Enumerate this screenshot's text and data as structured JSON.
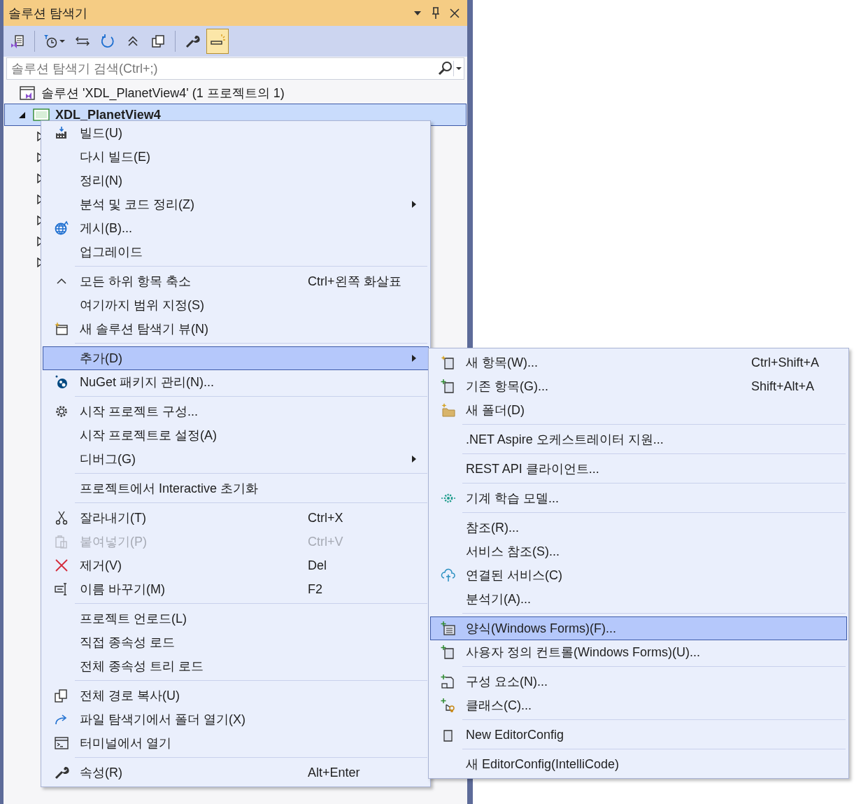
{
  "panel": {
    "title": "솔루션 탐색기"
  },
  "toolbar": {
    "buttons": [
      {
        "selected": false
      },
      {
        "selected": false
      },
      {
        "selected": false
      },
      {
        "selected": false
      },
      {
        "selected": false
      },
      {
        "selected": false
      },
      {
        "selected": false
      },
      {
        "selected": true
      }
    ]
  },
  "search": {
    "placeholder": "솔루션 탐색기 검색(Ctrl+;)"
  },
  "tree": {
    "solution": "솔루션 'XDL_PlanetView4'  (1 프로젝트의 1)",
    "project": {
      "label": "XDL_PlanetView4",
      "selected": true,
      "expanded": true,
      "children": [
        {
          "expanded": false
        },
        {
          "expanded": false
        },
        {
          "expanded": false
        },
        {
          "expanded": false
        },
        {
          "expanded": false
        },
        {
          "expanded": false
        },
        {
          "expanded": false
        }
      ]
    }
  },
  "context_menu": {
    "groups": [
      [
        {
          "label": "빌드(U)",
          "submenu": false,
          "selected": false,
          "disabled": false
        },
        {
          "label": "다시 빌드(E)",
          "submenu": false,
          "selected": false,
          "disabled": false
        },
        {
          "label": "정리(N)",
          "submenu": false,
          "selected": false,
          "disabled": false
        },
        {
          "label": "분석 및 코드 정리(Z)",
          "submenu": true,
          "selected": false,
          "disabled": false
        },
        {
          "label": "게시(B)...",
          "submenu": false,
          "selected": false,
          "disabled": false
        },
        {
          "label": "업그레이드",
          "submenu": false,
          "selected": false,
          "disabled": false
        }
      ],
      [
        {
          "label": "모든 하위 항목 축소",
          "shortcut": "Ctrl+왼쪽 화살표",
          "submenu": false,
          "selected": false,
          "disabled": false
        },
        {
          "label": "여기까지 범위 지정(S)",
          "submenu": false,
          "selected": false,
          "disabled": false
        },
        {
          "label": "새 솔루션 탐색기 뷰(N)",
          "submenu": false,
          "selected": false,
          "disabled": false
        }
      ],
      [
        {
          "label": "추가(D)",
          "submenu": true,
          "selected": true,
          "disabled": false
        },
        {
          "label": "NuGet 패키지 관리(N)...",
          "submenu": false,
          "selected": false,
          "disabled": false
        }
      ],
      [
        {
          "label": "시작 프로젝트 구성...",
          "submenu": false,
          "selected": false,
          "disabled": false
        },
        {
          "label": "시작 프로젝트로 설정(A)",
          "submenu": false,
          "selected": false,
          "disabled": false
        },
        {
          "label": "디버그(G)",
          "submenu": true,
          "selected": false,
          "disabled": false
        }
      ],
      [
        {
          "label": "프로젝트에서 Interactive 초기화",
          "submenu": false,
          "selected": false,
          "disabled": false
        }
      ],
      [
        {
          "label": "잘라내기(T)",
          "shortcut": "Ctrl+X",
          "submenu": false,
          "selected": false,
          "disabled": false
        },
        {
          "label": "붙여넣기(P)",
          "shortcut": "Ctrl+V",
          "submenu": false,
          "selected": false,
          "disabled": true
        },
        {
          "label": "제거(V)",
          "shortcut": "Del",
          "submenu": false,
          "selected": false,
          "disabled": false
        },
        {
          "label": "이름 바꾸기(M)",
          "shortcut": "F2",
          "submenu": false,
          "selected": false,
          "disabled": false
        }
      ],
      [
        {
          "label": "프로젝트 언로드(L)",
          "submenu": false,
          "selected": false,
          "disabled": false
        },
        {
          "label": "직접 종속성 로드",
          "submenu": false,
          "selected": false,
          "disabled": false
        },
        {
          "label": "전체 종속성 트리 로드",
          "submenu": false,
          "selected": false,
          "disabled": false
        }
      ],
      [
        {
          "label": "전체 경로 복사(U)",
          "submenu": false,
          "selected": false,
          "disabled": false
        },
        {
          "label": "파일 탐색기에서 폴더 열기(X)",
          "submenu": false,
          "selected": false,
          "disabled": false
        },
        {
          "label": "터미널에서 열기",
          "submenu": false,
          "selected": false,
          "disabled": false
        }
      ],
      [
        {
          "label": "속성(R)",
          "shortcut": "Alt+Enter",
          "submenu": false,
          "selected": false,
          "disabled": false
        }
      ]
    ]
  },
  "add_submenu": {
    "groups": [
      [
        {
          "label": "새 항목(W)...",
          "shortcut": "Ctrl+Shift+A",
          "selected": false
        },
        {
          "label": "기존 항목(G)...",
          "shortcut": "Shift+Alt+A",
          "selected": false
        },
        {
          "label": "새 폴더(D)",
          "selected": false
        }
      ],
      [
        {
          "label": ".NET Aspire 오케스트레이터 지원...",
          "selected": false
        }
      ],
      [
        {
          "label": "REST API 클라이언트...",
          "selected": false
        }
      ],
      [
        {
          "label": "기계 학습 모델...",
          "selected": false
        }
      ],
      [
        {
          "label": "참조(R)...",
          "selected": false
        },
        {
          "label": "서비스 참조(S)...",
          "selected": false
        },
        {
          "label": "연결된 서비스(C)",
          "selected": false
        },
        {
          "label": "분석기(A)...",
          "selected": false
        }
      ],
      [
        {
          "label": "양식(Windows Forms)(F)...",
          "selected": true
        },
        {
          "label": "사용자 정의 컨트롤(Windows Forms)(U)...",
          "selected": false
        }
      ],
      [
        {
          "label": "구성 요소(N)...",
          "selected": false
        },
        {
          "label": "클래스(C)...",
          "selected": false
        }
      ],
      [
        {
          "label": "New EditorConfig",
          "selected": false
        }
      ],
      [
        {
          "label": "새 EditorConfig(IntelliCode)",
          "selected": false
        }
      ]
    ]
  }
}
